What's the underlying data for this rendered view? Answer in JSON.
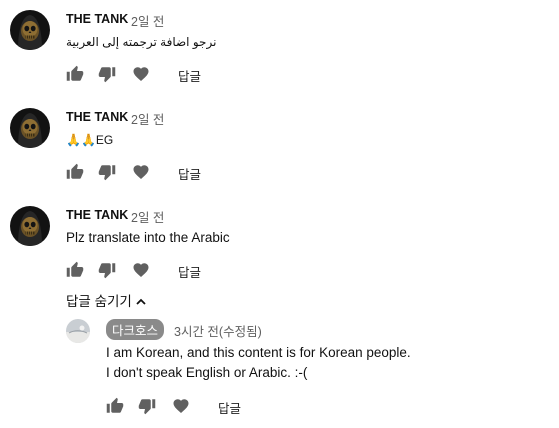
{
  "comments": [
    {
      "author": "THE TANK",
      "time": "2일 전",
      "text": "نرجو اضافة ترجمته إلى العربية",
      "reply_label": "답글"
    },
    {
      "author": "THE TANK",
      "time": "2일 전",
      "text": "🙏🙏EG",
      "reply_label": "답글"
    },
    {
      "author": "THE TANK",
      "time": "2일 전",
      "text": "Plz translate into the Arabic",
      "reply_label": "답글"
    }
  ],
  "replies_toggle": {
    "label": "답글 숨기기"
  },
  "reply": {
    "author": "다크호스",
    "time": "3시간 전(수정됨)",
    "lines": [
      "I am Korean, and this content is for Korean people.",
      "I don't speak English or Arabic.  :-("
    ],
    "reply_label": "답글"
  },
  "icons": {
    "like": "thumbs-up-icon",
    "dislike": "thumbs-down-icon",
    "heart": "heart-icon",
    "collapse": "chevron-up-icon"
  },
  "colors": {
    "badge_bg": "#8a8a8a",
    "icon": "#606060",
    "time": "#5f5f5f"
  }
}
